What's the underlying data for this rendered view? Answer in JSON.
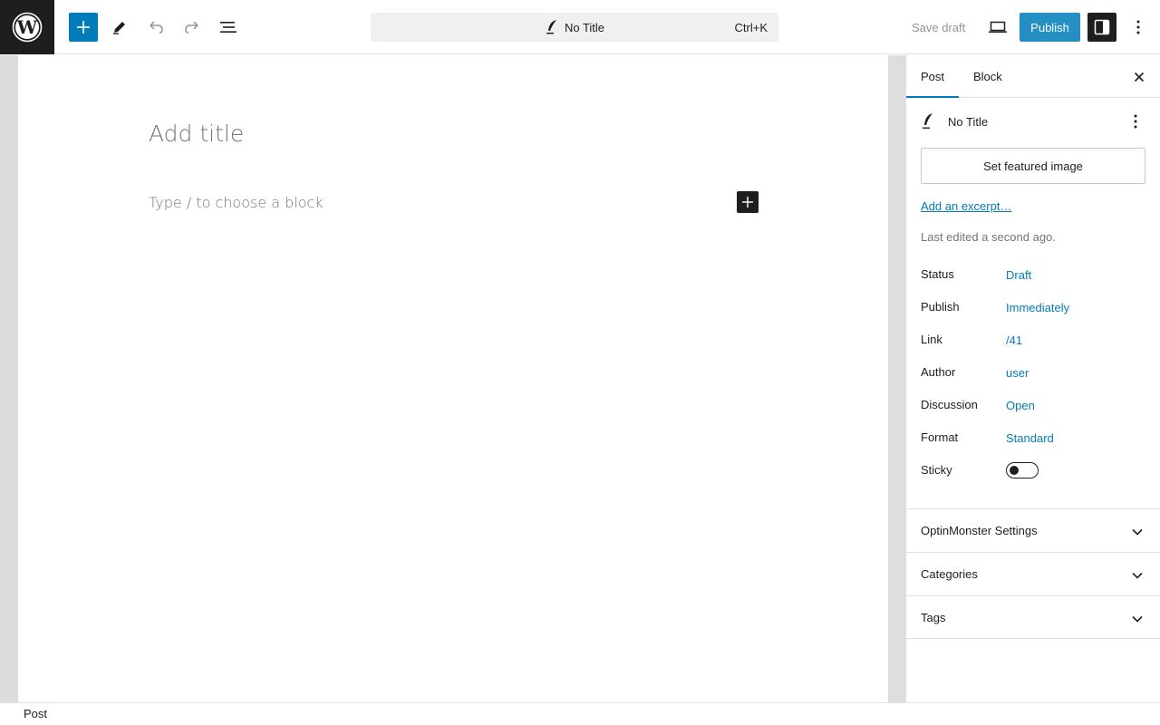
{
  "toolbar": {
    "document_title": "No Title",
    "shortcut": "Ctrl+K",
    "save_draft": "Save draft",
    "publish": "Publish"
  },
  "editor": {
    "title_placeholder": "Add title",
    "block_placeholder": "Type / to choose a block"
  },
  "sidebar": {
    "tabs": [
      {
        "label": "Post",
        "active": true
      },
      {
        "label": "Block",
        "active": false
      }
    ],
    "post_title": "No Title",
    "featured_image_button": "Set featured image",
    "excerpt_link": "Add an excerpt…",
    "last_edited": "Last edited a second ago.",
    "meta": [
      {
        "label": "Status",
        "value": "Draft"
      },
      {
        "label": "Publish",
        "value": "Immediately"
      },
      {
        "label": "Link",
        "value": "/41"
      },
      {
        "label": "Author",
        "value": "user"
      },
      {
        "label": "Discussion",
        "value": "Open"
      },
      {
        "label": "Format",
        "value": "Standard"
      }
    ],
    "sticky": {
      "label": "Sticky",
      "checked": false
    },
    "panels": [
      {
        "title": "OptinMonster Settings"
      },
      {
        "title": "Categories"
      },
      {
        "title": "Tags"
      }
    ]
  },
  "footer": {
    "breadcrumb": "Post"
  },
  "colors": {
    "accent": "#007cba",
    "dark": "#1e1e1e"
  }
}
